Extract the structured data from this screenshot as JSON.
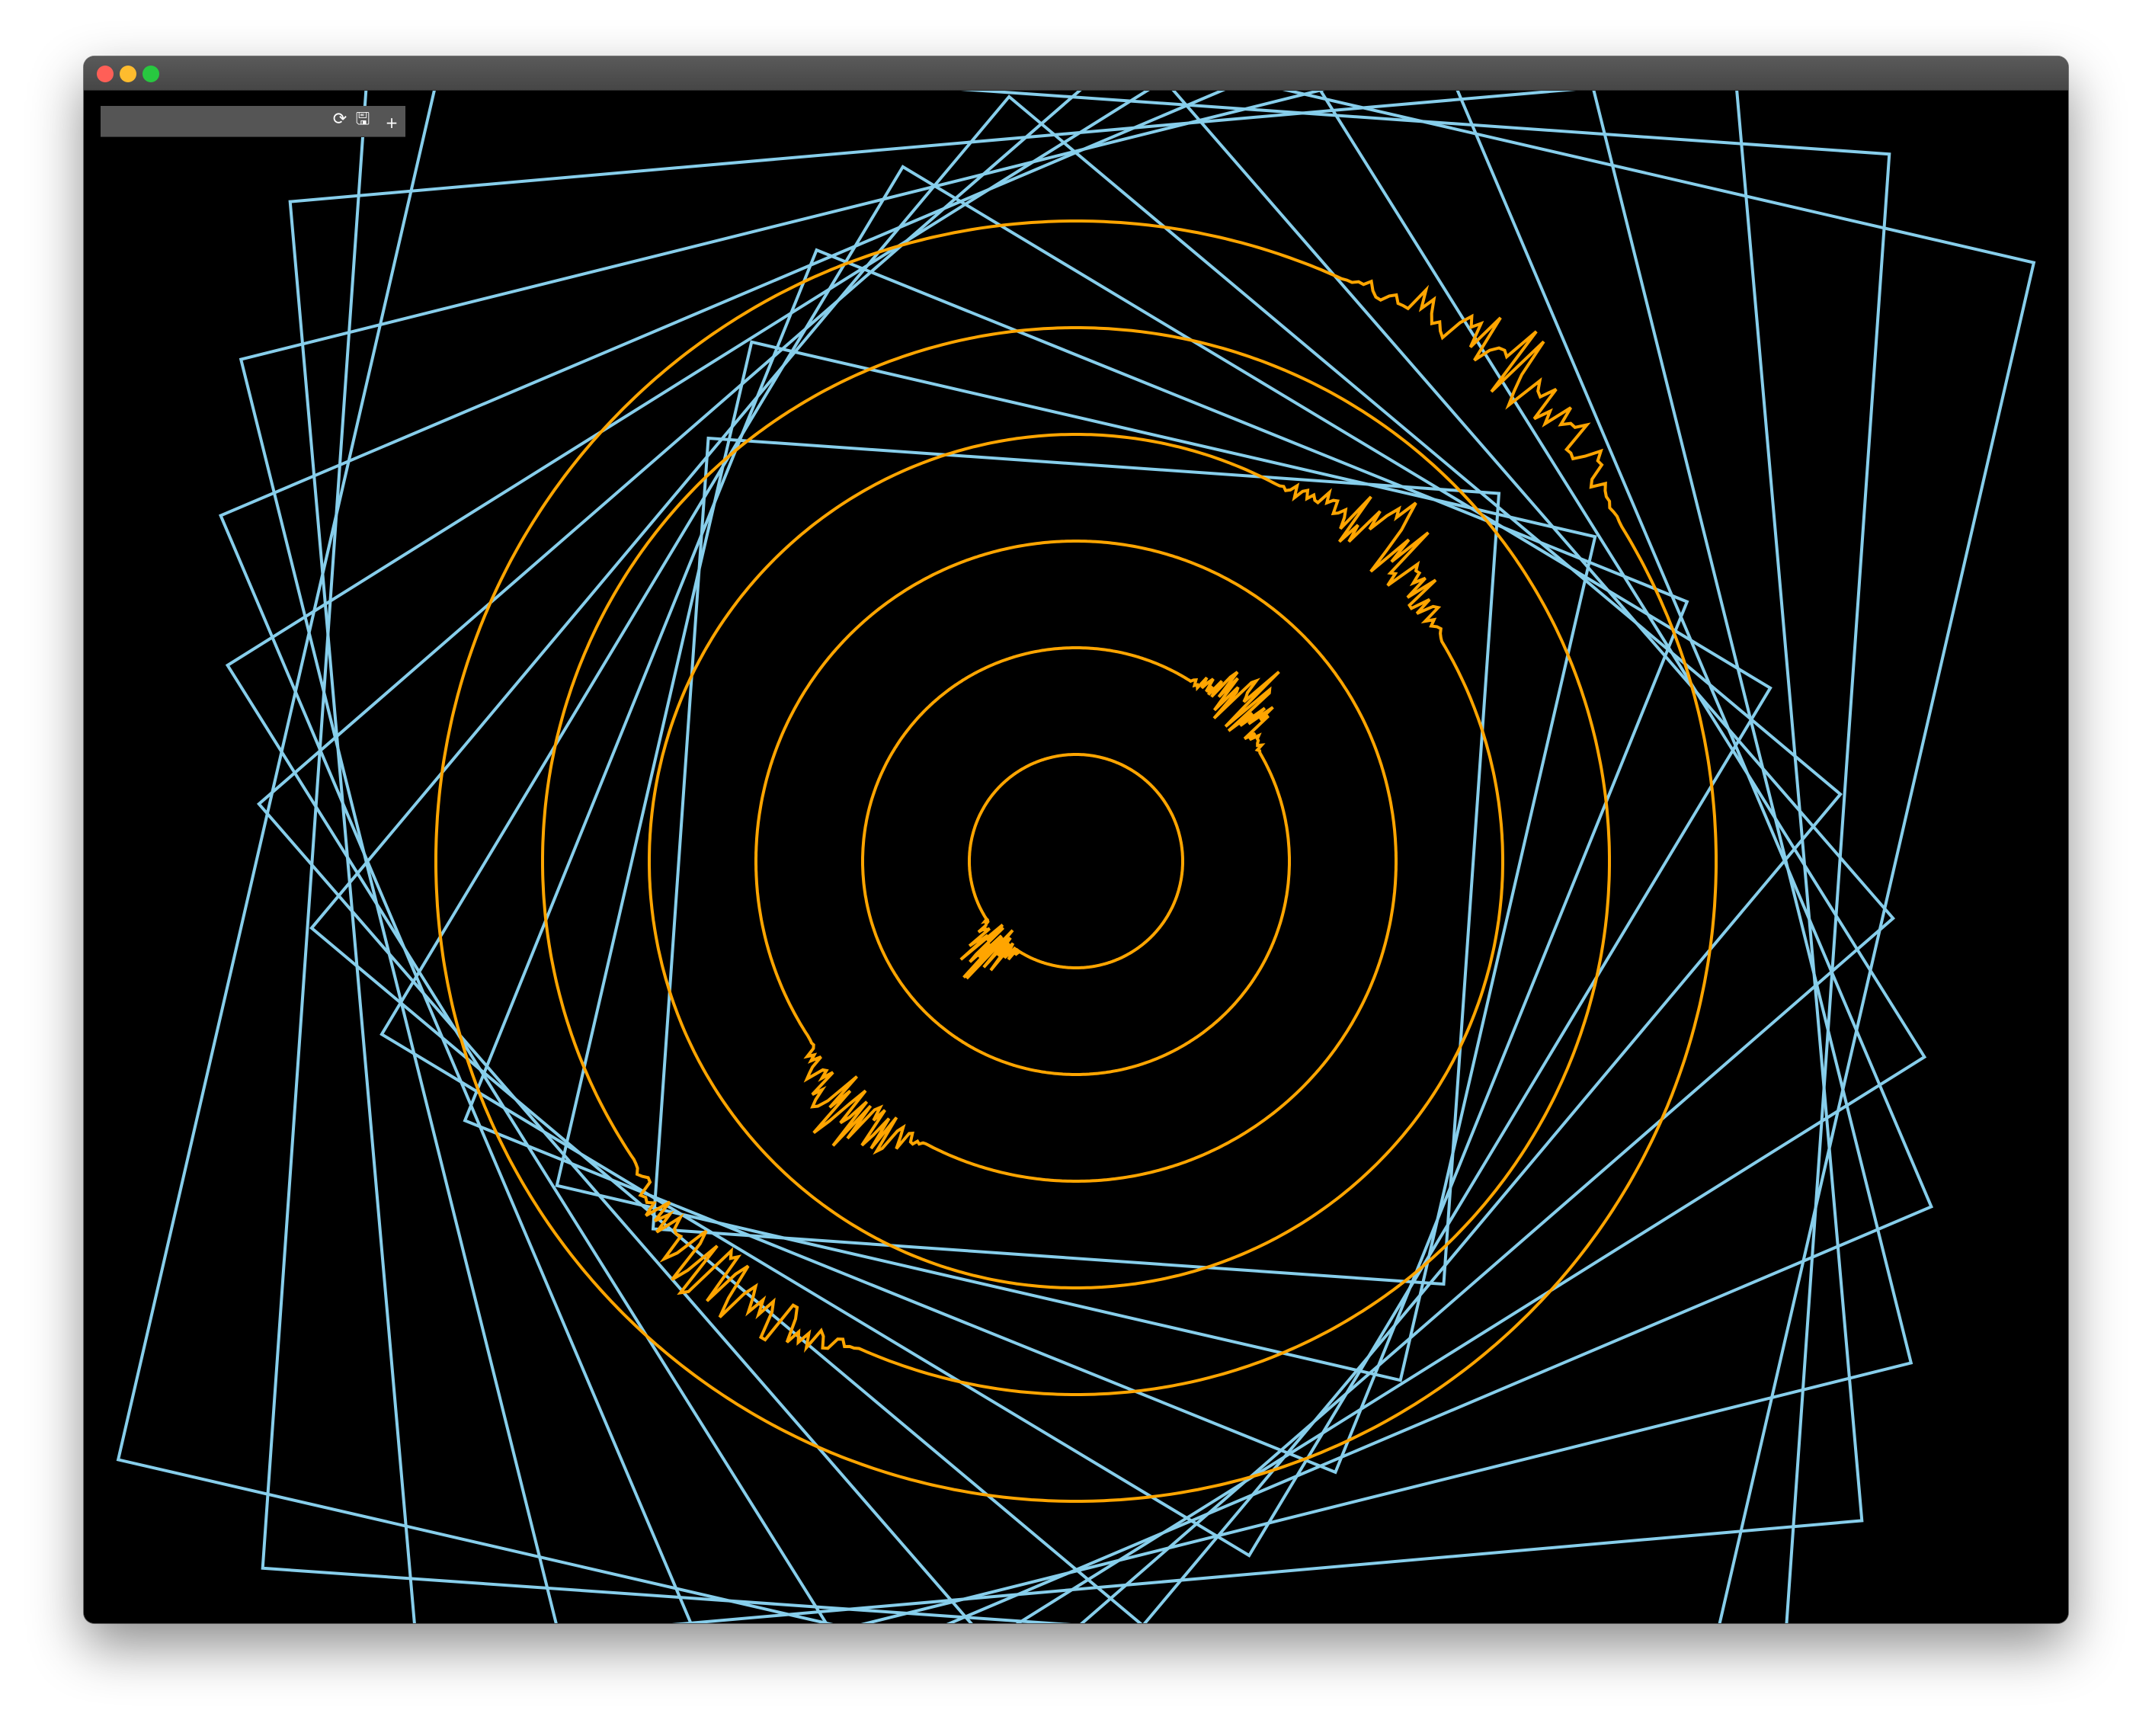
{
  "window": {
    "traffic_lights": {
      "close_color": "#ff5f57",
      "minimize_color": "#febc2e",
      "maximize_color": "#28c840"
    }
  },
  "toolbar": {
    "field_value": "",
    "refresh_icon": "refresh-icon",
    "save_icon": "save-icon",
    "add_icon": "plus-icon",
    "refresh_glyph": "⟳",
    "save_glyph": "🖫",
    "add_glyph": "+"
  },
  "visual": {
    "background_color": "#000000",
    "square_color": "#87ceeb",
    "circle_color": "#ffa500",
    "square_count": 12,
    "ring_count": 6
  }
}
